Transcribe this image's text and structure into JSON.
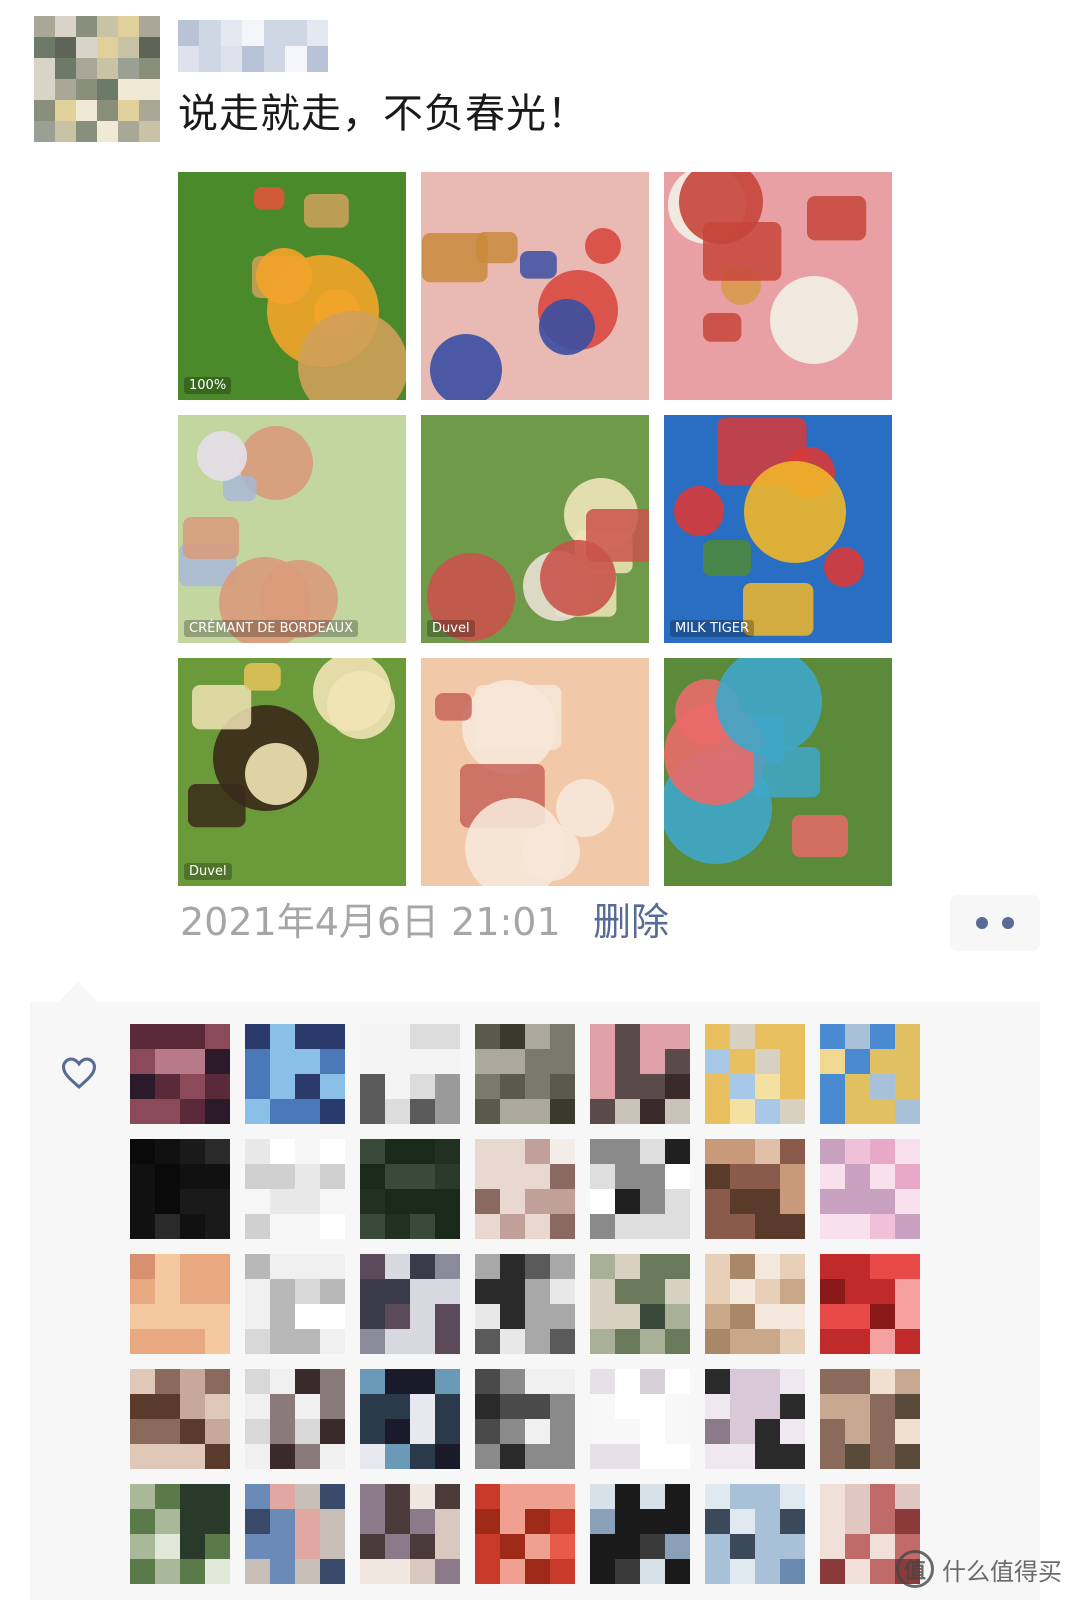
{
  "post": {
    "text": "说走就走，不负春光！",
    "timestamp": "2021年4月6日 21:01",
    "delete_label": "删除",
    "photos": [
      {
        "alt": "apple juice and orange juice bottles on grass",
        "label": "100%",
        "palette": [
          "#4a8a2a",
          "#f3a42a",
          "#e7533a",
          "#cfa05a"
        ]
      },
      {
        "alt": "picnic blanket with chocolate bunny, berries, pastries, sunflowers",
        "label": "",
        "palette": [
          "#e9b9b3",
          "#d9493f",
          "#c98a3b",
          "#3a4fa2"
        ]
      },
      {
        "alt": "roast chicken and snacks on red checkered cloth",
        "label": "",
        "palette": [
          "#e8a0a4",
          "#c7453a",
          "#d99a4f",
          "#f2efe6"
        ]
      },
      {
        "alt": "sparkling rose wine bottle held on grass",
        "label": "CRÉMANT DE BORDEAUX",
        "palette": [
          "#c3d6a0",
          "#e6dfe9",
          "#d99a7a",
          "#a7b9d6"
        ]
      },
      {
        "alt": "picnic scene with balloons and beer box",
        "label": "Duvel",
        "palette": [
          "#6f9a4a",
          "#e8e0d3",
          "#c9534a",
          "#f0e6b8"
        ]
      },
      {
        "alt": "blue cloth with cereal box, strawberries and vegetables",
        "label": "MILK TIGER",
        "palette": [
          "#2a6ec4",
          "#f0b62a",
          "#d8393a",
          "#4e8a36"
        ]
      },
      {
        "alt": "beer glass and Duvel bottles on grass",
        "label": "Duvel",
        "palette": [
          "#6b9a3a",
          "#f1e3b5",
          "#3a2a1a",
          "#e6c35a"
        ]
      },
      {
        "alt": "swiss roll cake and sandwiches",
        "label": "",
        "palette": [
          "#f2c9a8",
          "#e7a27a",
          "#f6e7d8",
          "#c8655a"
        ]
      },
      {
        "alt": "white teepee tent with picnic spread",
        "label": "",
        "palette": [
          "#5a8a3a",
          "#f1efea",
          "#3fa6c9",
          "#e96a6a"
        ]
      }
    ]
  },
  "likes": {
    "heart_icon": "heart-outline-icon",
    "count_rows": 5,
    "count_cols": 7
  },
  "watermark": {
    "badge": "值",
    "text": "什么值得买"
  },
  "colors": {
    "link": "#576b95",
    "meta": "#a6a6a6",
    "likes_bg": "#f7f7f7"
  }
}
